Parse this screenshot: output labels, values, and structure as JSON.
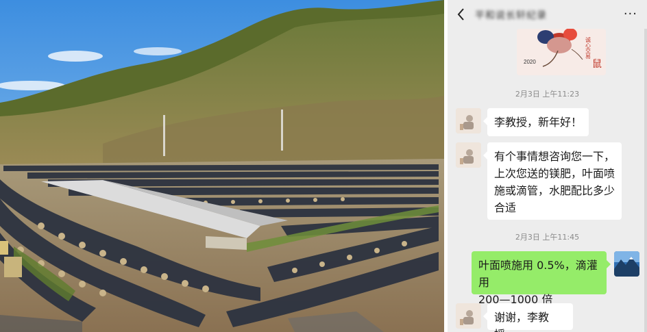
{
  "chat": {
    "title": "平和说长轩纪录",
    "more_label": "···",
    "sticker": {
      "year": "2020",
      "text1": "诚心交易",
      "text2": "鼠"
    },
    "messages": [
      {
        "timestamp": "2月3日 上午11:23"
      },
      {
        "sender": "contact",
        "text": "李教授，新年好！"
      },
      {
        "sender": "contact",
        "lines": [
          "有个事情想咨询您一下，",
          "上次您送的镁肥，叶面喷",
          "施或滴管，水肥配比多少",
          "合适"
        ]
      },
      {
        "timestamp": "2月3日 上午11:45"
      },
      {
        "sender": "me",
        "lines": [
          "叶面喷施用 0.5%，滴灌用",
          "200—1000 倍"
        ]
      },
      {
        "sender": "contact",
        "text": "谢谢，李教授。"
      }
    ]
  },
  "colors": {
    "chat_bg": "#ededed",
    "mine_bubble": "#95ec69",
    "other_bubble": "#ffffff",
    "timestamp": "#8a8a8a"
  },
  "icons": [
    "back-arrow-icon",
    "more-options-icon"
  ]
}
